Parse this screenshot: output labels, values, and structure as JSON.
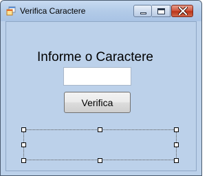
{
  "window": {
    "title": "Verifica Caractere",
    "icon": "app-form-icon",
    "controls": [
      "minimize-icon",
      "maximize-icon",
      "close-icon"
    ]
  },
  "form": {
    "label": "Informe o Caractere",
    "input_value": "",
    "button_label": "Verifica"
  },
  "colors": {
    "client_background": "#bcd1ea",
    "title_gradient_top": "#c8dbf1",
    "close_button": "#c9452c"
  }
}
